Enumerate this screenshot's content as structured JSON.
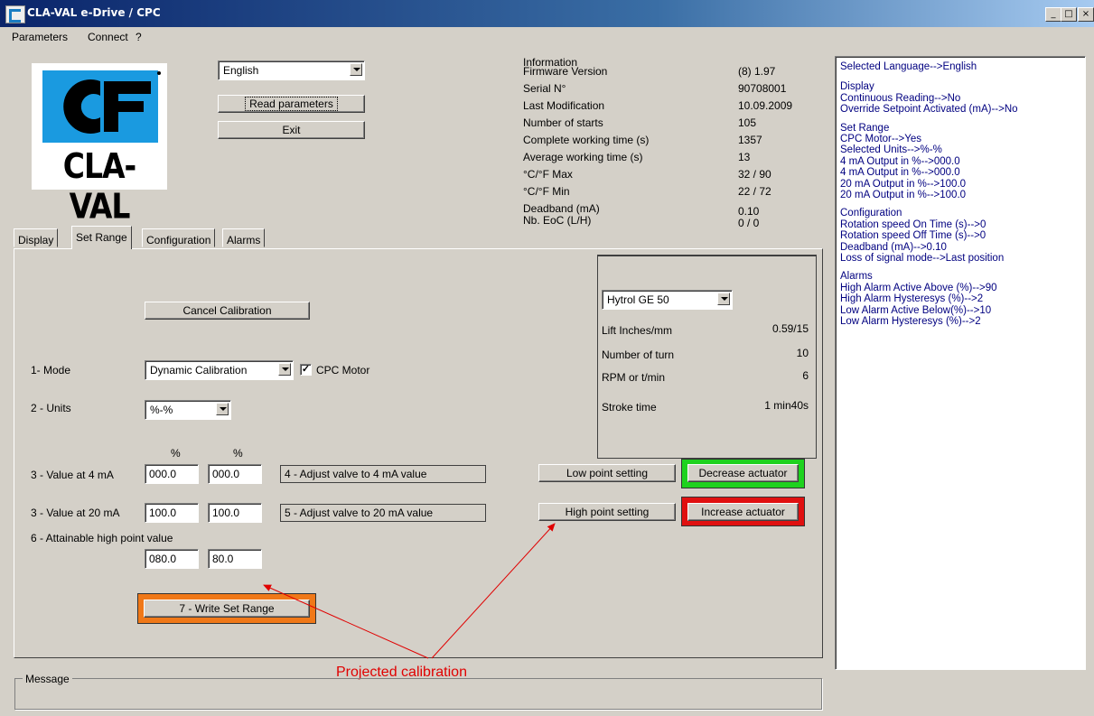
{
  "window": {
    "title": "CLA-VAL e-Drive / CPC",
    "min_glyph": "_",
    "max_glyph": "□",
    "close_glyph": "×"
  },
  "menu": [
    "Parameters",
    "Connect",
    "?"
  ],
  "logo_text": "CLA-VAL",
  "language": {
    "selected": "English"
  },
  "buttons": {
    "read_parameters": "Read parameters",
    "exit": "Exit",
    "cancel_calibration": "Cancel Calibration",
    "low_point": "Low point setting",
    "high_point": "High point setting",
    "decrease_actuator": "Decrease actuator",
    "increase_actuator": "Increase actuator",
    "write_set_range": "7 - Write Set Range"
  },
  "information": {
    "title": "Information",
    "rows": [
      {
        "label": "Firmware Version",
        "value": "(8) 1.97"
      },
      {
        "label": "Serial N°",
        "value": "90708001"
      },
      {
        "label": "Last Modification",
        "value": "10.09.2009"
      },
      {
        "label": "Number of starts",
        "value": "105"
      },
      {
        "label": "Complete working time (s)",
        "value": "1357"
      },
      {
        "label": "Average working time (s)",
        "value": "13"
      },
      {
        "label": "°C/°F Max",
        "value": "32 / 90"
      },
      {
        "label": "°C/°F Min",
        "value": "22 / 72"
      },
      {
        "label": "Deadband (mA)",
        "value": "0.10"
      },
      {
        "label": "Nb. EoC (L/H)",
        "value": "0 / 0"
      }
    ]
  },
  "tabs": [
    "Display",
    "Set Range",
    "Configuration",
    "Alarms"
  ],
  "valve": {
    "model": "Hytrol GE 50",
    "rows": [
      {
        "label": "Lift Inches/mm",
        "value": "0.59/15"
      },
      {
        "label": "Number of turn",
        "value": "10"
      },
      {
        "label": "RPM or t/min",
        "value": "6"
      },
      {
        "label": "Stroke time",
        "value": "1 min40s"
      }
    ]
  },
  "form": {
    "mode_label": "1- Mode",
    "mode_value": "Dynamic Calibration",
    "cpc_motor_label": "CPC Motor",
    "cpc_motor_check": "✓",
    "units_label": "2 - Units",
    "units_value": "%-%",
    "pct1": "%",
    "pct2": "%",
    "value4_label": "3 - Value at 4 mA",
    "value4_a": "000.0",
    "value4_b": "000.0",
    "adjust4": "4 - Adjust valve to 4 mA value",
    "value20_label": "3 - Value at 20 mA",
    "value20_a": "100.0",
    "value20_b": "100.0",
    "adjust20": "5 - Adjust valve to 20 mA value",
    "attainable_label": "6 - Attainable high point value",
    "attainable_a": "080.0",
    "attainable_b": "80.0"
  },
  "annotation": "Projected calibration",
  "message_label": "Message",
  "summary": [
    "Selected Language-->English",
    "",
    "Display",
    "Continuous Reading-->No",
    "Override Setpoint Activated (mA)-->No",
    "",
    "Set Range",
    "CPC Motor-->Yes",
    "Selected Units-->%-%",
    "4 mA Output in %-->000.0",
    "4 mA Output in %-->000.0",
    "20 mA Output in %-->100.0",
    "20 mA Output in %-->100.0",
    "",
    "Configuration",
    "Rotation speed On Time (s)-->0",
    "Rotation speed Off Time (s)-->0",
    "Deadband (mA)-->0.10",
    "Loss of signal mode-->Last position",
    "",
    "Alarms",
    "High Alarm Active Above (%)-->90",
    "High Alarm Hysteresys (%)-->2",
    "Low Alarm Active Below(%)-->10",
    "Low Alarm Hysteresys (%)-->2"
  ],
  "colors": {
    "green_frame": "#1ed21e",
    "red_frame": "#e01010",
    "orange_frame": "#f07818",
    "annotation": "#e00000",
    "summary_text": "#000080"
  }
}
